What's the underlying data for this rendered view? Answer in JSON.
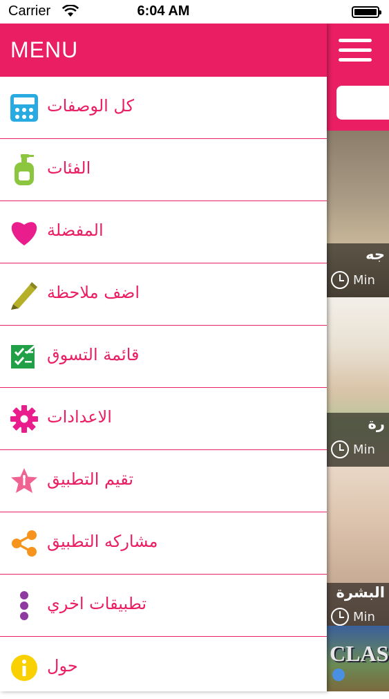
{
  "status_bar": {
    "carrier": "Carrier",
    "time": "6:04 AM"
  },
  "drawer": {
    "title": "MENU",
    "items": [
      {
        "label": "كل الوصفات",
        "icon": "calculator-icon",
        "color": "#29abe2"
      },
      {
        "label": "الفئات",
        "icon": "lotion-bottle-icon",
        "color": "#8cc63f"
      },
      {
        "label": "المفضلة",
        "icon": "heart-icon",
        "color": "#e91e8c"
      },
      {
        "label": "اضف ملاحظة",
        "icon": "pencil-icon",
        "color": "#b5b028"
      },
      {
        "label": "قائمة التسوق",
        "icon": "checklist-icon",
        "color": "#22a047"
      },
      {
        "label": "الاعدادات",
        "icon": "gear-icon",
        "color": "#e91e8c"
      },
      {
        "label": "تقيم التطبيق",
        "icon": "star-icon",
        "color": "#f06292"
      },
      {
        "label": "مشاركه التطبيق",
        "icon": "share-icon",
        "color": "#f7941d"
      },
      {
        "label": "تطبيقات اخري",
        "icon": "more-vertical-icon",
        "color": "#8e3aa0"
      },
      {
        "label": "حول",
        "icon": "info-icon",
        "color": "#f9d100"
      }
    ]
  },
  "background_screen": {
    "accent_color": "#e91e63",
    "cards": [
      {
        "title": "جه",
        "meta": "Min"
      },
      {
        "title": "رة",
        "meta": "Min"
      },
      {
        "title": "البشرة",
        "meta": "Min"
      },
      {
        "title": "CLAS",
        "meta": ""
      }
    ]
  }
}
